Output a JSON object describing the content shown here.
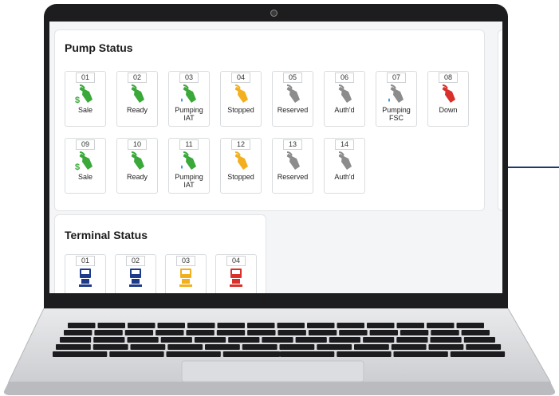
{
  "pump_status": {
    "title": "Pump Status",
    "pumps": [
      {
        "num": "01",
        "label": "Sale",
        "color": "#3aa93a",
        "icon": "pump-nozzle-sale-icon"
      },
      {
        "num": "02",
        "label": "Ready",
        "color": "#3aa93a",
        "icon": "pump-nozzle-icon"
      },
      {
        "num": "03",
        "label": "Pumping\nIAT",
        "color": "#3aa93a",
        "icon": "pump-nozzle-pumping-icon"
      },
      {
        "num": "04",
        "label": "Stopped",
        "color": "#f2b01e",
        "icon": "pump-nozzle-icon"
      },
      {
        "num": "05",
        "label": "Reserved",
        "color": "#8c8c8c",
        "icon": "pump-nozzle-icon"
      },
      {
        "num": "06",
        "label": "Auth'd",
        "color": "#8c8c8c",
        "icon": "pump-nozzle-icon"
      },
      {
        "num": "07",
        "label": "Pumping\nFSC",
        "color": "#8c8c8c",
        "icon": "pump-nozzle-pumping-icon"
      },
      {
        "num": "08",
        "label": "Down",
        "color": "#d9302b",
        "icon": "pump-nozzle-icon"
      },
      {
        "num": "09",
        "label": "Sale",
        "color": "#3aa93a",
        "icon": "pump-nozzle-sale-icon"
      },
      {
        "num": "10",
        "label": "Ready",
        "color": "#3aa93a",
        "icon": "pump-nozzle-icon"
      },
      {
        "num": "11",
        "label": "Pumping\nIAT",
        "color": "#3aa93a",
        "icon": "pump-nozzle-pumping-icon"
      },
      {
        "num": "12",
        "label": "Stopped",
        "color": "#f2b01e",
        "icon": "pump-nozzle-icon"
      },
      {
        "num": "13",
        "label": "Reserved",
        "color": "#8c8c8c",
        "icon": "pump-nozzle-icon"
      },
      {
        "num": "14",
        "label": "Auth'd",
        "color": "#8c8c8c",
        "icon": "pump-nozzle-icon"
      }
    ]
  },
  "terminal_status": {
    "title": "Terminal Status",
    "terminals": [
      {
        "num": "01",
        "color": "#1e3a8a",
        "icon": "terminal-icon"
      },
      {
        "num": "02",
        "color": "#1e3a8a",
        "icon": "terminal-icon"
      },
      {
        "num": "03",
        "color": "#f2b01e",
        "icon": "terminal-icon"
      },
      {
        "num": "04",
        "color": "#d9302b",
        "icon": "terminal-icon"
      }
    ]
  }
}
